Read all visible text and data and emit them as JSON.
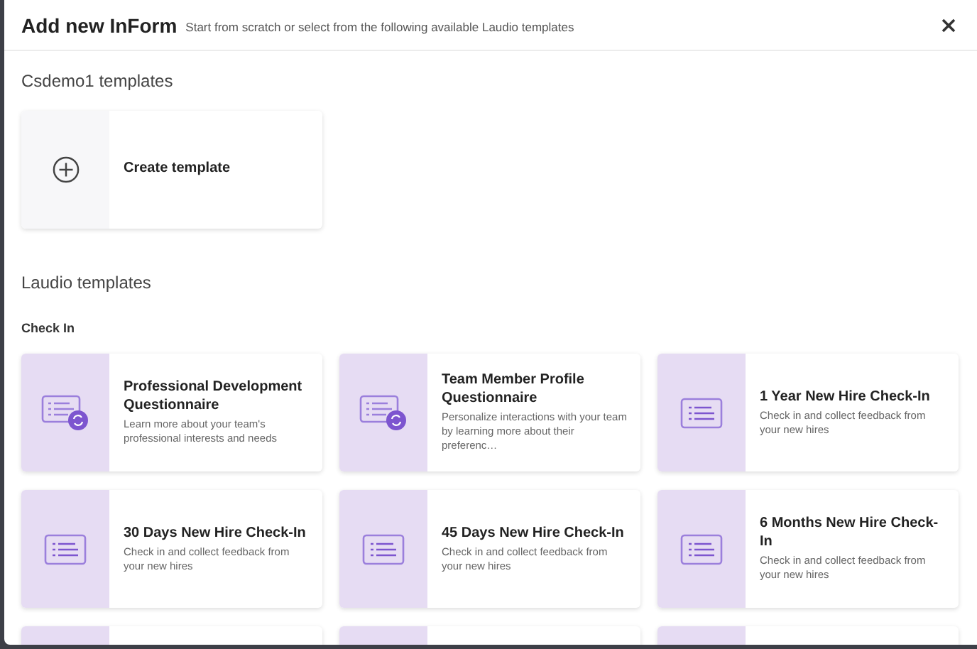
{
  "dialog": {
    "title": "Add new InForm",
    "subtitle": "Start from scratch or select from the following available Laudio templates"
  },
  "own_section": {
    "heading": "Csdemo1 templates",
    "create_card": {
      "label": "Create template"
    }
  },
  "laudio_section": {
    "heading": "Laudio templates",
    "groups": [
      {
        "heading": "Check In",
        "templates": [
          {
            "kind": "sync",
            "title": "Professional Development Questionnaire",
            "description": "Learn more about your team's professional interests and needs"
          },
          {
            "kind": "sync",
            "title": "Team Member Profile Questionnaire",
            "description": "Personalize interactions with your team by learning more about their preferenc…"
          },
          {
            "kind": "list",
            "title": "1 Year New Hire Check-In",
            "description": "Check in and collect feedback from your new hires"
          },
          {
            "kind": "list",
            "title": "30 Days New Hire Check-In",
            "description": "Check in and collect feedback from your new hires"
          },
          {
            "kind": "list",
            "title": "45 Days New Hire Check-In",
            "description": "Check in and collect feedback from your new hires"
          },
          {
            "kind": "list",
            "title": "6 Months New Hire Check-In",
            "description": "Check in and collect feedback from your new hires"
          }
        ]
      }
    ]
  }
}
